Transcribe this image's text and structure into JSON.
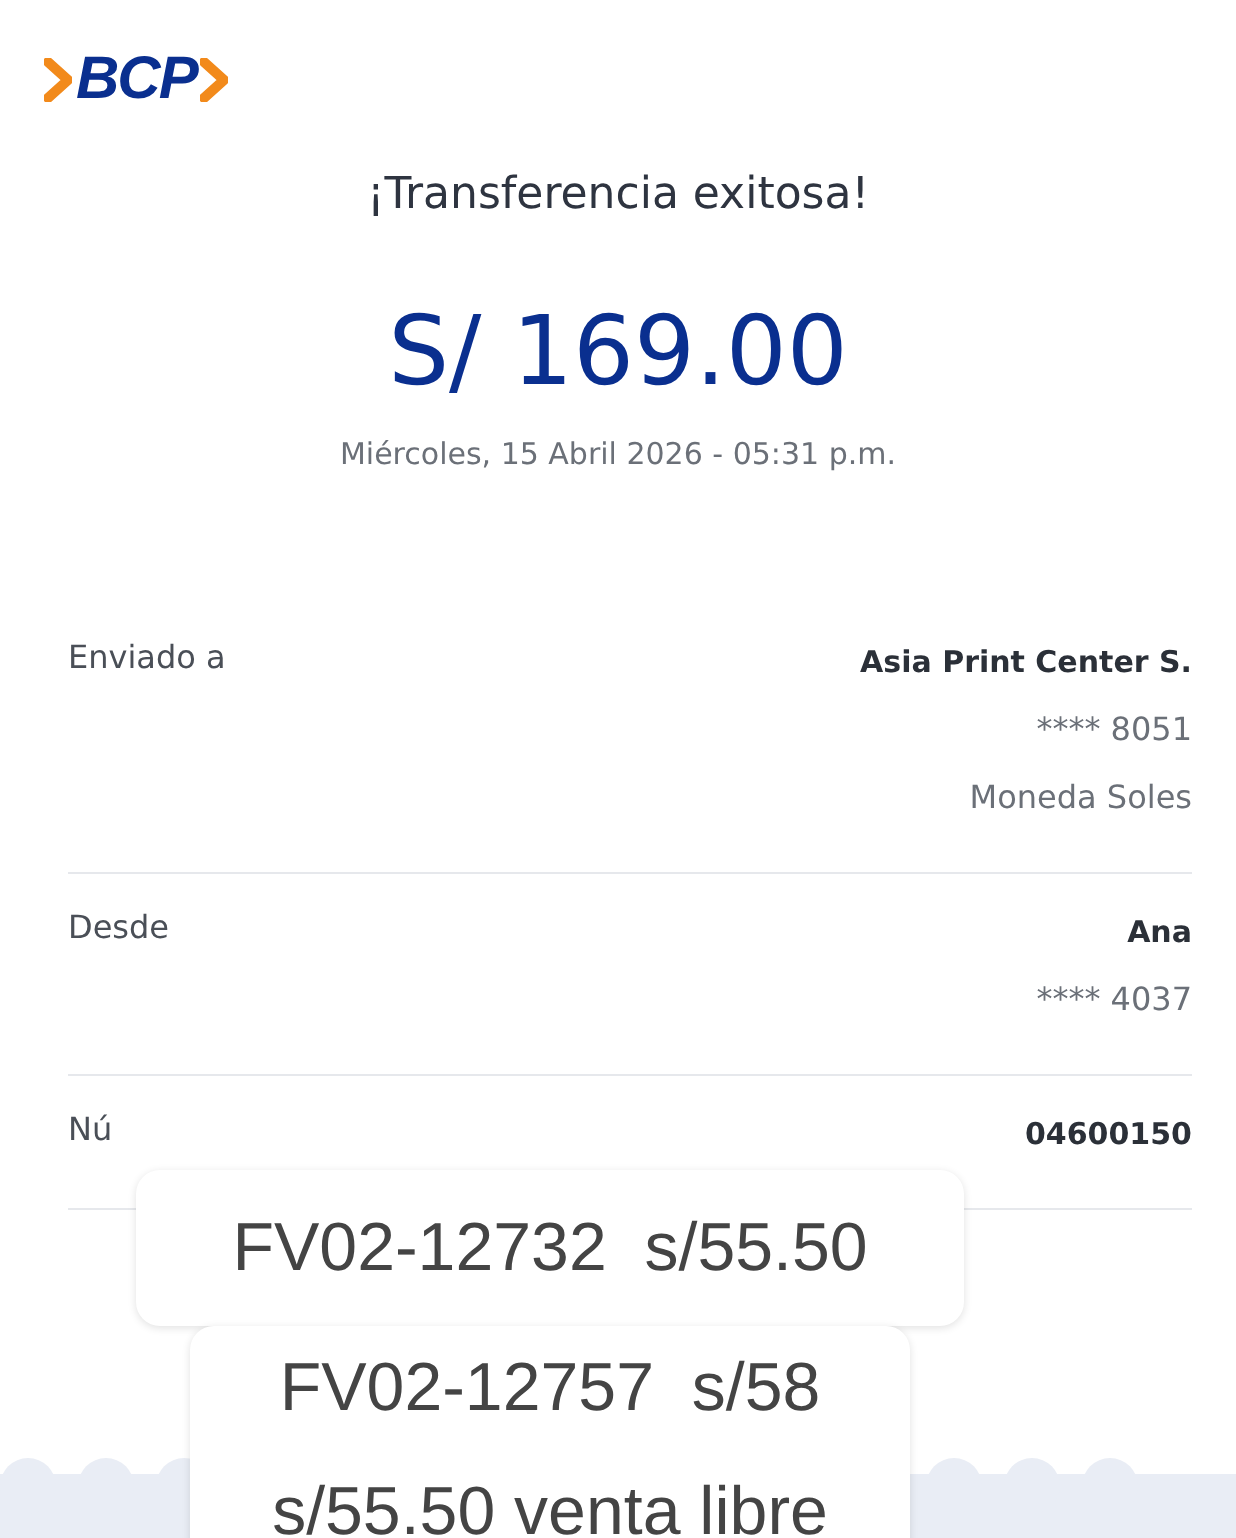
{
  "logo": {
    "text": "BCP"
  },
  "title": "¡Transferencia exitosa!",
  "amount": "S/ 169.00",
  "date": "Miércoles, 15 Abril 2026 - 05:31 p.m.",
  "details": [
    {
      "label": "Enviado a",
      "values": [
        {
          "text": "Asia Print Center S.",
          "strong": true
        },
        {
          "text": "**** 8051",
          "strong": false
        },
        {
          "text": "Moneda Soles",
          "strong": false
        }
      ]
    },
    {
      "label": "Desde",
      "values": [
        {
          "text": "Ana",
          "strong": true
        },
        {
          "text": "**** 4037",
          "strong": false
        }
      ]
    },
    {
      "label": "Nú",
      "values": [
        {
          "text": "04600150",
          "strong": true
        }
      ]
    }
  ],
  "overlay_note": {
    "boxes": [
      {
        "lines": [
          "FV02-12732  s/55.50"
        ]
      },
      {
        "lines": [
          "FV02-12757  s/58",
          "s/55.50 venta libre"
        ]
      }
    ]
  }
}
